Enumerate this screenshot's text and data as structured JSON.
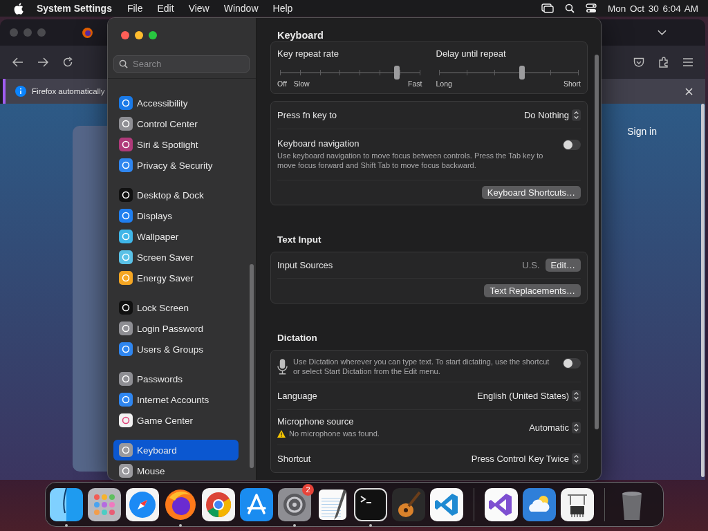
{
  "menubar": {
    "app_name": "System Settings",
    "menus": [
      "File",
      "Edit",
      "View",
      "Window",
      "Help"
    ],
    "clock": "Mon Oct 30 6:04 AM"
  },
  "browser": {
    "notification": "Firefox automatically",
    "sign_in": "Sign in"
  },
  "settings": {
    "search_placeholder": "Search",
    "title": "Keyboard",
    "sidebar_groups": [
      {
        "items": [
          {
            "label": "Accessibility",
            "color": "#1a7ae8",
            "selected": false
          },
          {
            "label": "Control Center",
            "color": "#8e8e93",
            "selected": false
          },
          {
            "label": "Siri & Spotlight",
            "color": "#b03a7a",
            "selected": false
          },
          {
            "label": "Privacy & Security",
            "color": "#2f86f0",
            "selected": false
          }
        ]
      },
      {
        "items": [
          {
            "label": "Desktop & Dock",
            "color": "#111111",
            "selected": false
          },
          {
            "label": "Displays",
            "color": "#1f7ff0",
            "selected": false
          },
          {
            "label": "Wallpaper",
            "color": "#3fb6e8",
            "selected": false
          },
          {
            "label": "Screen Saver",
            "color": "#5ac1e6",
            "selected": false
          },
          {
            "label": "Energy Saver",
            "color": "#f5a623",
            "selected": false
          }
        ]
      },
      {
        "items": [
          {
            "label": "Lock Screen",
            "color": "#111111",
            "selected": false
          },
          {
            "label": "Login Password",
            "color": "#8e8e93",
            "selected": false
          },
          {
            "label": "Users & Groups",
            "color": "#2f86f0",
            "selected": false
          }
        ]
      },
      {
        "items": [
          {
            "label": "Passwords",
            "color": "#8e8e93",
            "selected": false
          },
          {
            "label": "Internet Accounts",
            "color": "#2f86f0",
            "selected": false
          },
          {
            "label": "Game Center",
            "color": "#f2f2f2",
            "selected": false
          }
        ]
      },
      {
        "items": [
          {
            "label": "Keyboard",
            "color": "#9a9a9e",
            "selected": true
          },
          {
            "label": "Mouse",
            "color": "#9a9a9e",
            "selected": false
          }
        ]
      }
    ],
    "cards": [
      {
        "kind": "sliders",
        "sliders": [
          {
            "label": "Key repeat rate",
            "level": 0.84,
            "start_labels": [
              "Off",
              "Slow"
            ],
            "end_label": "Fast"
          },
          {
            "label": "Delay until repeat",
            "level": 0.6,
            "start_labels": [
              "Long"
            ],
            "end_label": "Short"
          }
        ]
      },
      {
        "kind": "rows",
        "rows": [
          {
            "kind": "popup",
            "label": "Press fn key to",
            "value": "Do Nothing"
          },
          {
            "kind": "toggle",
            "label": "Keyboard navigation",
            "description": "Use keyboard navigation to move focus between controls. Press the Tab key to move focus forward and Shift Tab to move focus backward.",
            "on": false
          },
          {
            "kind": "button",
            "button": "Keyboard Shortcuts…"
          }
        ]
      },
      {
        "kind": "rows",
        "title": "Text Input",
        "rows": [
          {
            "kind": "value_button",
            "label": "Input Sources",
            "value": "U.S.",
            "button": "Edit…"
          },
          {
            "kind": "button",
            "button": "Text Replacements…"
          }
        ]
      },
      {
        "kind": "rows",
        "title": "Dictation",
        "rows": [
          {
            "kind": "mic_toggle",
            "description": "Use Dictation wherever you can type text. To start dictating, use the shortcut or select Start Dictation from the Edit menu.",
            "on": false
          },
          {
            "kind": "popup",
            "label": "Language",
            "value": "English (United States)"
          },
          {
            "kind": "popup",
            "label": "Microphone source",
            "value": "Automatic",
            "warning": "No microphone was found."
          },
          {
            "kind": "popup",
            "label": "Shortcut",
            "value": "Press Control Key Twice"
          }
        ]
      }
    ]
  },
  "dock": [
    {
      "kind": "finder",
      "running": true
    },
    {
      "kind": "launchpad",
      "running": false
    },
    {
      "kind": "safari",
      "running": false
    },
    {
      "kind": "firefox",
      "running": true
    },
    {
      "kind": "chrome",
      "running": false
    },
    {
      "kind": "appstore",
      "running": false
    },
    {
      "kind": "settings",
      "running": true,
      "badge": "2"
    },
    {
      "kind": "textedit",
      "running": false
    },
    {
      "kind": "terminal",
      "running": true
    },
    {
      "kind": "guitar",
      "running": false
    },
    {
      "kind": "vscode",
      "running": false
    },
    {
      "kind": "divider"
    },
    {
      "kind": "vstudio",
      "running": false
    },
    {
      "kind": "weather",
      "running": false
    },
    {
      "kind": "sysinfo",
      "running": false
    },
    {
      "kind": "divider"
    },
    {
      "kind": "trash",
      "running": false
    }
  ]
}
